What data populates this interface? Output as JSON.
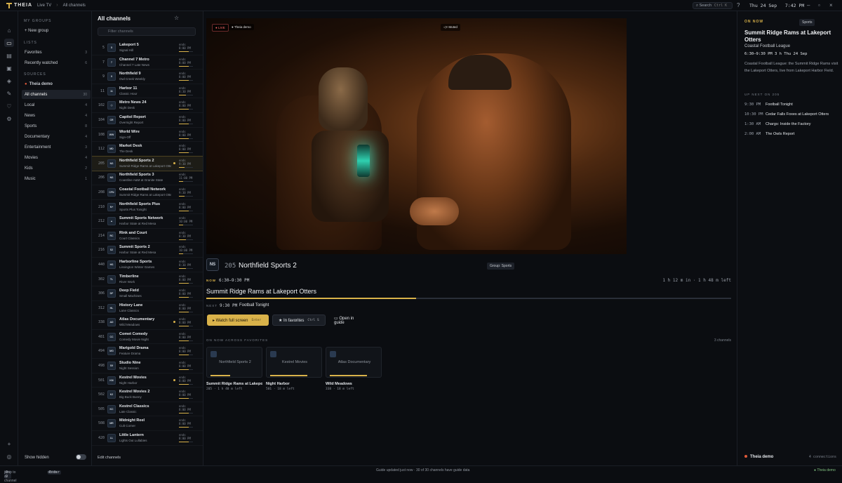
{
  "app": {
    "brand": "THEIA",
    "crumbs": [
      "Live TV",
      "All channels"
    ],
    "search_label": "Search",
    "search_kbd": "Ctrl K",
    "clock_day": "Thu 24 Sep",
    "clock_time": "7:42 PM"
  },
  "groups": {
    "my_groups_header": "MY GROUPS",
    "new_group": "+ New group",
    "lists_header": "LISTS",
    "lists": [
      {
        "label": "Favorites",
        "count": "3"
      },
      {
        "label": "Recently watched",
        "count": "6"
      }
    ],
    "sources_header": "SOURCES",
    "source": "Theia demo",
    "items": [
      {
        "label": "All channels",
        "count": "30"
      },
      {
        "label": "Local",
        "count": "4"
      },
      {
        "label": "News",
        "count": "4"
      },
      {
        "label": "Sports",
        "count": "8"
      },
      {
        "label": "Documentary",
        "count": "4"
      },
      {
        "label": "Entertainment",
        "count": "3"
      },
      {
        "label": "Movies",
        "count": "4"
      },
      {
        "label": "Kids",
        "count": "2"
      },
      {
        "label": "Music",
        "count": "1"
      }
    ],
    "show_hidden": "Show hidden"
  },
  "channels": {
    "title": "All channels",
    "count": "30",
    "filter_placeholder": "Filter channels",
    "edit": "Edit channels",
    "ends_label": "ends",
    "rows": [
      {
        "num": "5",
        "logo": "5",
        "name": "Lakeport 5",
        "prog": "Signal Hill",
        "ends": "8:00 PM",
        "p": 0.7
      },
      {
        "num": "7",
        "logo": "7",
        "name": "Channel 7 Metro",
        "prog": "Channel 7 Late News",
        "ends": "8:00 PM",
        "p": 0.7
      },
      {
        "num": "9",
        "logo": "9",
        "name": "Northfield 9",
        "prog": "Owl Creek Weekly",
        "ends": "8:00 PM",
        "p": 0.7
      },
      {
        "num": "11",
        "logo": "11",
        "name": "Harbor 11",
        "prog": "Classic Hour",
        "ends": "8:30 PM",
        "p": 0.5
      },
      {
        "num": "102",
        "logo": "◎",
        "name": "Metro News 24",
        "prog": "Night Desk",
        "ends": "8:00 PM",
        "p": 0.7
      },
      {
        "num": "104",
        "logo": "CR",
        "name": "Capitol Report",
        "prog": "Overnight Report",
        "ends": "8:00 PM",
        "p": 0.7
      },
      {
        "num": "108",
        "logo": "WW",
        "name": "World Wire",
        "prog": "Sign-Off",
        "ends": "8:00 PM",
        "p": 0.7
      },
      {
        "num": "112",
        "logo": "MD",
        "name": "Market Desk",
        "prog": "The Desk",
        "ends": "8:00 PM",
        "p": 0.7
      },
      {
        "num": "205",
        "logo": "NS",
        "name": "Northfield Sports 2",
        "prog": "Summit Ridge Rams at Lakeport Otters",
        "ends": "9:30 PM",
        "p": 0.4,
        "sel": true,
        "dot": true
      },
      {
        "num": "206",
        "logo": "NS",
        "name": "Northfield Sports 3",
        "prog": "Coastline A&M at Granite State",
        "ends": "11:00 PM",
        "p": 0.3
      },
      {
        "num": "208",
        "logo": "CFN",
        "name": "Coastal Football Network",
        "prog": "Summit Ridge Rams at Lakeport Otters",
        "ends": "9:30 PM",
        "p": 0.4
      },
      {
        "num": "210",
        "logo": "N+",
        "name": "Northfield Sports Plus",
        "prog": "Sports Plus Tonight",
        "ends": "8:00 PM",
        "p": 0.7
      },
      {
        "num": "212",
        "logo": "▲",
        "name": "Summit Sports Network",
        "prog": "Harbor State at Red Mesa",
        "ends": "10:00 PM",
        "p": 0.3
      },
      {
        "num": "214",
        "logo": "RC",
        "name": "Rink and Court",
        "prog": "Court Classics",
        "ends": "8:30 PM",
        "p": 0.5
      },
      {
        "num": "216",
        "logo": "S2",
        "name": "Summit Sports 2",
        "prog": "Harbor State at Red Mesa",
        "ends": "10:00 PM",
        "p": 0.3
      },
      {
        "num": "440",
        "logo": "HS",
        "name": "Harborline Sports",
        "prog": "Lissington Winter Games",
        "ends": "8:30 PM",
        "p": 0.5
      },
      {
        "num": "302",
        "logo": "TL",
        "name": "Timberline",
        "prog": "River Work",
        "ends": "8:00 PM",
        "p": 0.7
      },
      {
        "num": "306",
        "logo": "DF",
        "name": "Deep Field",
        "prog": "Small Machines",
        "ends": "8:00 PM",
        "p": 0.7
      },
      {
        "num": "312",
        "logo": "HL",
        "name": "History Lane",
        "prog": "Lane Classics",
        "ends": "8:00 PM",
        "p": 0.7
      },
      {
        "num": "338",
        "logo": "AD",
        "name": "Atlas Documentary",
        "prog": "Wild Meadows",
        "ends": "8:00 PM",
        "p": 0.7,
        "dot": true
      },
      {
        "num": "481",
        "logo": "CC",
        "name": "Comet Comedy",
        "prog": "Comedy Movie Night",
        "ends": "8:00 PM",
        "p": 0.7
      },
      {
        "num": "494",
        "logo": "MG",
        "name": "Marigold Drama",
        "prog": "Feature Drama",
        "ends": "8:00 PM",
        "p": 0.7
      },
      {
        "num": "498",
        "logo": "S9",
        "name": "Studio Nine",
        "prog": "Night Session",
        "ends": "8:00 PM",
        "p": 0.7
      },
      {
        "num": "501",
        "logo": "KM",
        "name": "Kestrel Movies",
        "prog": "Night Harbor",
        "ends": "8:00 PM",
        "p": 0.7,
        "dot": true
      },
      {
        "num": "502",
        "logo": "K2",
        "name": "Kestrel Movies 2",
        "prog": "Big Buck Bunny",
        "ends": "8:00 PM",
        "p": 0.7
      },
      {
        "num": "505",
        "logo": "KC",
        "name": "Kestrel Classics",
        "prog": "Late Classic",
        "ends": "8:00 PM",
        "p": 0.7
      },
      {
        "num": "508",
        "logo": "MR",
        "name": "Midnight Reel",
        "prog": "Cult Corner",
        "ends": "8:00 PM",
        "p": 0.7
      },
      {
        "num": "420",
        "logo": "LL",
        "name": "Little Lantern",
        "prog": "Lights Out Lullabies",
        "ends": "8:00 PM",
        "p": 0.7
      }
    ]
  },
  "player": {
    "live": "● LIVE",
    "source": "● Theia demo",
    "muted": "◁× Muted"
  },
  "now": {
    "logo": "NS",
    "num": "205",
    "name": "Northfield Sports 2",
    "group": "Group: Sports",
    "now_label": "NOW",
    "time": "6:30–9:30 PM",
    "left": "1 h 12 m in · 1 h 48 m left",
    "title": "Summit Ridge Rams at Lakeport Otters",
    "progress": 0.4,
    "next_label": "NEXT",
    "next_time": "9:30 PM",
    "next_title": "Football Tonight",
    "watch": "▸  Watch full screen",
    "watch_kbd": "Enter",
    "fav": "★  In favorites",
    "fav_kbd": "Ctrl S",
    "guide": "▭  Open in guide",
    "fav_header": "ON NOW ACROSS FAVORITES",
    "fav_count": "3 channels",
    "favs": [
      {
        "thumb": "Northfield Sports 2",
        "title": "Summit Ridge Rams at Lakeport Otters",
        "sub": "205 · 1 h 48 m left",
        "p": 0.4
      },
      {
        "thumb": "Kestrel Movies",
        "title": "Night Harbor",
        "sub": "501 · 18 m left",
        "p": 0.75
      },
      {
        "thumb": "Atlas Documentary",
        "title": "Wild Meadows",
        "sub": "338 · 18 m left",
        "p": 0.75
      }
    ]
  },
  "side": {
    "on_now": "ON NOW",
    "tag": "Sports",
    "title": "Summit Ridge Rams at Lakeport Otters",
    "league": "Coastal Football League",
    "time": "6:30–9:30 PM  3 h  Thu 24 Sep",
    "desc": "Coastal Football League: the Summit Ridge Rams visit the Lakeport Otters, live from Lakeport Harbor Field.",
    "up_header": "UP NEXT ON 205",
    "up": [
      {
        "t": "9:30 PM",
        "n": "Football Tonight"
      },
      {
        "t": "10:30 PM",
        "n": "Cedar Falls Foxes at Lakeport Otters"
      },
      {
        "t": "1:30 AM",
        "n": "Chargs: Inside the Factory"
      },
      {
        "t": "2:00 AM",
        "n": "The Owls Report"
      }
    ],
    "footer": "Theia demo",
    "connections": "4 connections"
  },
  "status": {
    "k1": "0–9",
    "t1": "jump to a channel",
    "k2": "Enter",
    "t2": "watch",
    "center": "Guide updated just now · 30 of 30 channels have guide data",
    "right": "● Theia demo"
  }
}
